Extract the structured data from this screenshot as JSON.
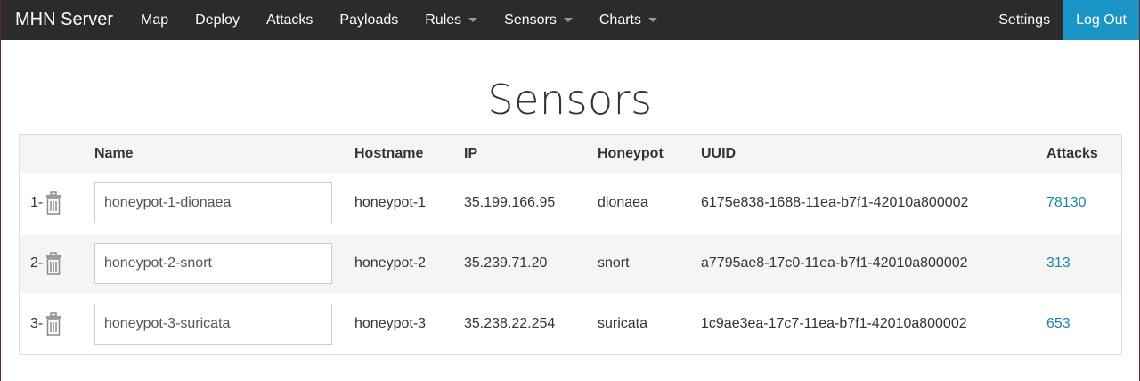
{
  "navbar": {
    "brand": "MHN Server",
    "items": [
      {
        "label": "Map",
        "dropdown": false
      },
      {
        "label": "Deploy",
        "dropdown": false
      },
      {
        "label": "Attacks",
        "dropdown": false
      },
      {
        "label": "Payloads",
        "dropdown": false
      },
      {
        "label": "Rules",
        "dropdown": true
      },
      {
        "label": "Sensors",
        "dropdown": true
      },
      {
        "label": "Charts",
        "dropdown": true
      }
    ],
    "settings_label": "Settings",
    "logout_label": "Log Out"
  },
  "page": {
    "title": "Sensors"
  },
  "table": {
    "headers": {
      "name": "Name",
      "hostname": "Hostname",
      "ip": "IP",
      "honeypot": "Honeypot",
      "uuid": "UUID",
      "attacks": "Attacks"
    },
    "rows": [
      {
        "index": "1-",
        "name": "honeypot-1-dionaea",
        "hostname": "honeypot-1",
        "ip": "35.199.166.95",
        "honeypot": "dionaea",
        "uuid": "6175e838-1688-11ea-b7f1-42010a800002",
        "attacks": "78130"
      },
      {
        "index": "2-",
        "name": "honeypot-2-snort",
        "hostname": "honeypot-2",
        "ip": "35.239.71.20",
        "honeypot": "snort",
        "uuid": "a7795ae8-17c0-11ea-b7f1-42010a800002",
        "attacks": "313"
      },
      {
        "index": "3-",
        "name": "honeypot-3-suricata",
        "hostname": "honeypot-3",
        "ip": "35.238.22.254",
        "honeypot": "suricata",
        "uuid": "1c9ae3ea-17c7-11ea-b7f1-42010a800002",
        "attacks": "653"
      }
    ]
  },
  "colors": {
    "navbar_bg": "#2b2b2b",
    "logout_bg": "#1b95c6",
    "link": "#1b86b3",
    "stripe": "#f5f5f5"
  }
}
